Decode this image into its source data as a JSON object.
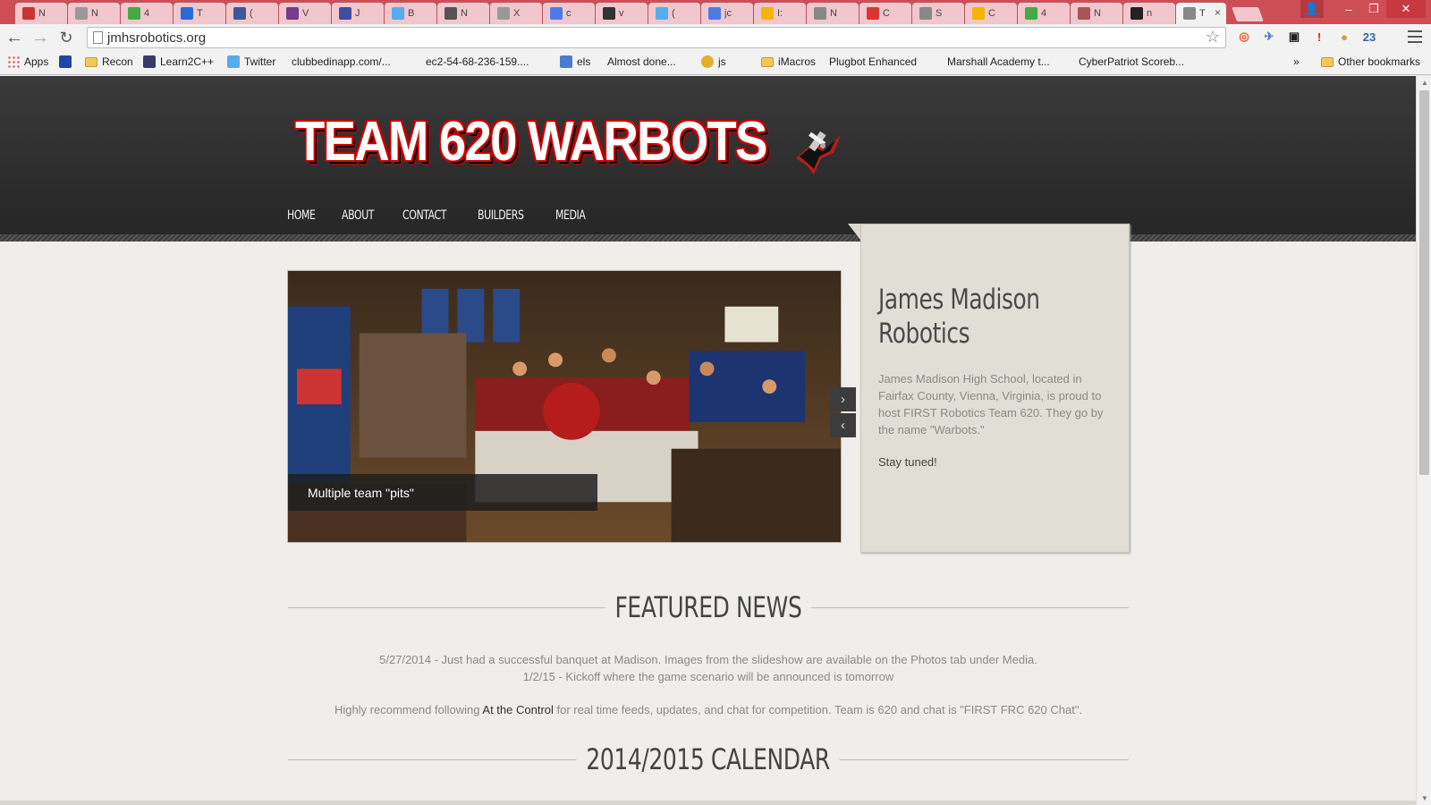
{
  "browser": {
    "tabs": [
      {
        "label": "N",
        "icon": "gmail-red-icon",
        "color": "#c33"
      },
      {
        "label": "N",
        "icon": "page-icon",
        "color": "#999"
      },
      {
        "label": "4",
        "icon": "maps-icon",
        "color": "#4a4"
      },
      {
        "label": "T",
        "icon": "blue-app-icon",
        "color": "#2a6ad8"
      },
      {
        "label": "(",
        "icon": "facebook-icon",
        "color": "#3b5998"
      },
      {
        "label": "V",
        "icon": "vs-icon",
        "color": "#7a3a8a"
      },
      {
        "label": "J",
        "icon": "d-icon",
        "color": "#3d4ea0"
      },
      {
        "label": "B",
        "icon": "twitter-icon",
        "color": "#55acee"
      },
      {
        "label": "N",
        "icon": "m-icon",
        "color": "#555"
      },
      {
        "label": "X",
        "icon": "page-icon",
        "color": "#999"
      },
      {
        "label": "c",
        "icon": "google-plus-icon",
        "color": "#4c7be6"
      },
      {
        "label": "v",
        "icon": "robot-icon",
        "color": "#333"
      },
      {
        "label": "(",
        "icon": "twitter-icon",
        "color": "#55acee"
      },
      {
        "label": "jc",
        "icon": "google-plus-icon",
        "color": "#4c7be6"
      },
      {
        "label": "I:",
        "icon": "drive-icon",
        "color": "#f4b400"
      },
      {
        "label": "N",
        "icon": "image-icon",
        "color": "#888"
      },
      {
        "label": "C",
        "icon": "gmail-icon",
        "color": "#d33"
      },
      {
        "label": "S",
        "icon": "star-icon",
        "color": "#888"
      },
      {
        "label": "C",
        "icon": "drive-icon",
        "color": "#f4b400"
      },
      {
        "label": "4",
        "icon": "maps-icon",
        "color": "#4a4"
      },
      {
        "label": "N",
        "icon": "pencil-icon",
        "color": "#a55"
      },
      {
        "label": "n",
        "icon": "github-icon",
        "color": "#222"
      },
      {
        "label": "T",
        "icon": "warbots-icon",
        "color": "#888",
        "active": true
      }
    ],
    "active_tab_close": "×",
    "url": "jmhsrobotics.org",
    "window": {
      "minimize": "‒",
      "maximize": "❐",
      "close": "✕",
      "user": "👤"
    },
    "extensions": [
      {
        "icon": "ubuntu-icon",
        "glyph": "◎",
        "color": "#e95420"
      },
      {
        "icon": "airplane-icon",
        "glyph": "✈",
        "color": "#5577cc"
      },
      {
        "icon": "glasses-icon",
        "glyph": "▣",
        "color": "#222"
      },
      {
        "icon": "stop-icon",
        "glyph": "!",
        "color": "#d22"
      },
      {
        "icon": "cookie-icon",
        "glyph": "●",
        "color": "#d59a3b"
      },
      {
        "icon": "calendar-icon",
        "glyph": "23",
        "color": "#3366aa"
      }
    ],
    "bookmarks": [
      {
        "label": "Apps",
        "type": "apps"
      },
      {
        "label": "",
        "type": "blue"
      },
      {
        "label": "Recon",
        "type": "folder"
      },
      {
        "label": "Learn2C++",
        "type": "cpp"
      },
      {
        "label": "Twitter",
        "type": "twitter"
      },
      {
        "label": "clubbedinapp.com/...",
        "type": "page"
      },
      {
        "label": "ec2-54-68-236-159....",
        "type": "page"
      },
      {
        "label": "els",
        "type": "calendar"
      },
      {
        "label": "Almost done...",
        "type": "page"
      },
      {
        "label": "js",
        "type": "chrome"
      },
      {
        "label": "",
        "type": "page"
      },
      {
        "label": "iMacros",
        "type": "folder"
      },
      {
        "label": "Plugbot Enhanced",
        "type": "page"
      },
      {
        "label": "Marshall Academy t...",
        "type": "page"
      },
      {
        "label": "CyberPatriot Scoreb...",
        "type": "page"
      }
    ],
    "more_bookmarks": "»",
    "other_bookmarks": "Other bookmarks"
  },
  "site": {
    "logo_text": "TEAM 620 WARBOTS",
    "nav": [
      "HOME",
      "ABOUT",
      "CONTACT",
      "BUILDERS",
      "MEDIA"
    ],
    "slider": {
      "caption": "Multiple team \"pits\"",
      "next": "›",
      "prev": "‹"
    },
    "intro": {
      "title": "James Madison Robotics",
      "text": "James Madison High School, located in Fairfax County, Vienna, Virginia, is proud to host FIRST Robotics Team 620. They go by the name \"Warbots.\"",
      "stay": "Stay tuned!"
    },
    "featured": {
      "title": "FEATURED NEWS",
      "line1": "5/27/2014 - Just had a successful banquet at Madison. Images from the slideshow are available on the Photos tab under Media.",
      "line2": "1/2/15 - Kickoff where the game scenario will be announced is tomorrow",
      "line3_pre": "Highly recommend following ",
      "line3_link": "At the Control",
      "line3_post": " for real time feeds, updates, and chat for competition. Team is 620 and chat is \"FIRST FRC 620 Chat\"."
    },
    "calendar": {
      "title": "2014/2015 CALENDAR"
    }
  }
}
